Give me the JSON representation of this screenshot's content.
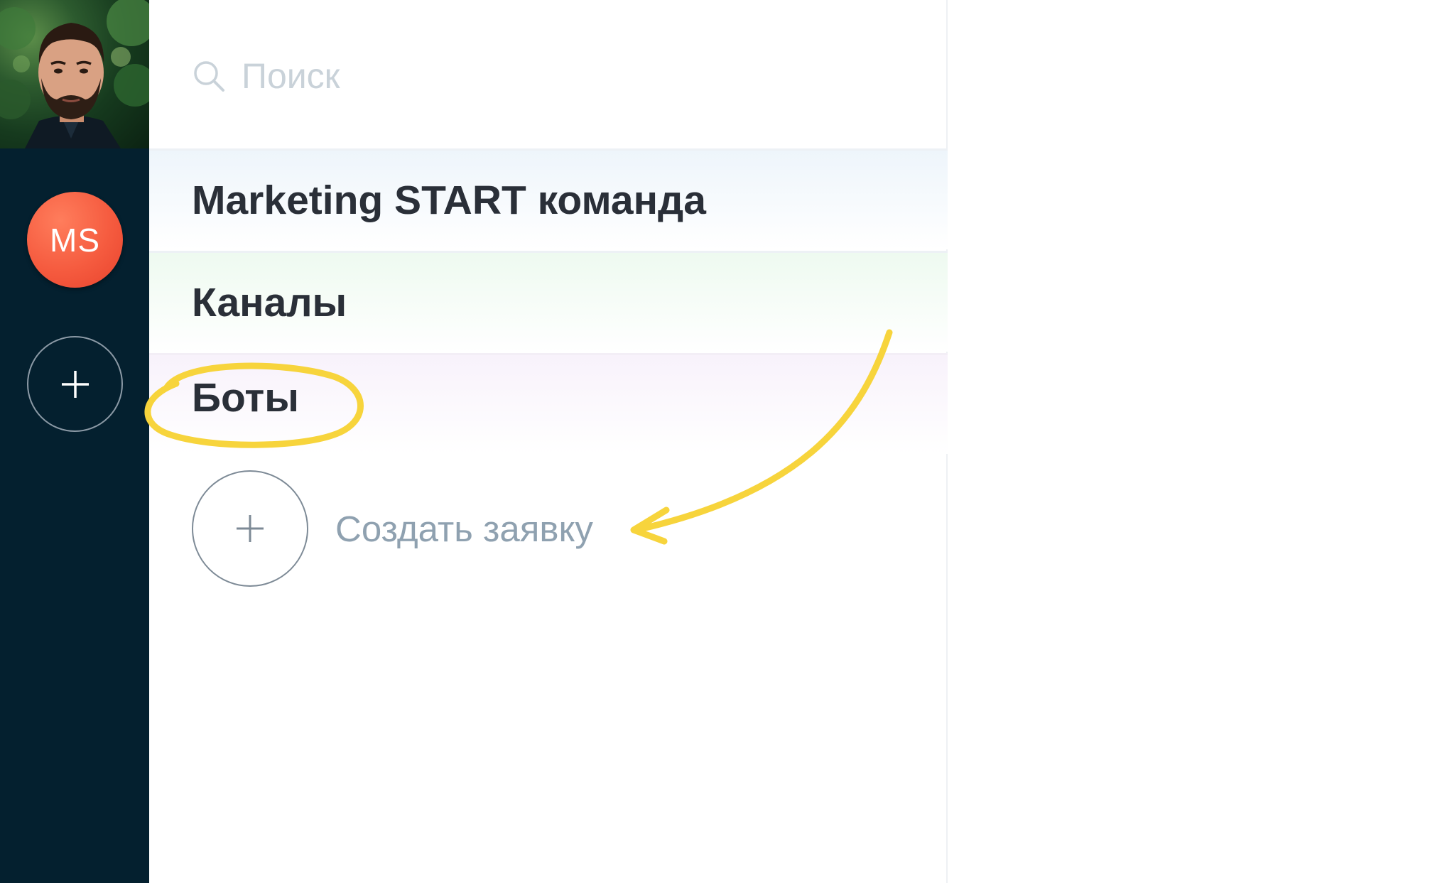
{
  "rail": {
    "profile_photo_alt": "",
    "team_avatar_initials": "MS",
    "add_icon": "plus-icon"
  },
  "search": {
    "icon": "search-icon",
    "placeholder": "Поиск"
  },
  "sections": {
    "team_title": "Marketing START команда",
    "channels_title": "Каналы",
    "bots_title": "Боты"
  },
  "create": {
    "icon": "plus-icon",
    "label": "Создать заявку"
  },
  "colors": {
    "rail_bg": "#04202f",
    "avatar_accent": "#f55b3f",
    "annotation_yellow": "#f7d43c",
    "muted_text": "#8fa1b0"
  }
}
